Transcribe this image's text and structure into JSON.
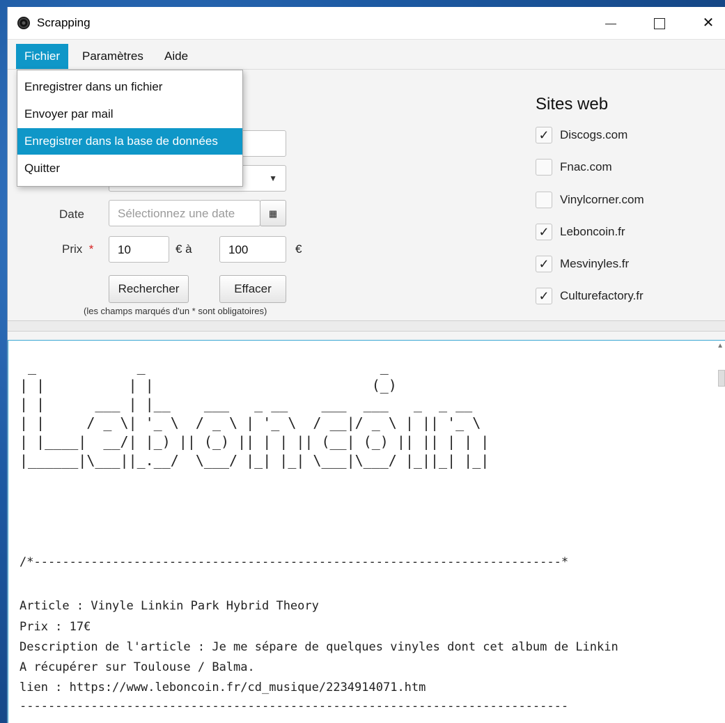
{
  "window": {
    "title": "Scrapping"
  },
  "menu": {
    "items": [
      {
        "label": "Fichier"
      },
      {
        "label": "Paramètres"
      },
      {
        "label": "Aide"
      }
    ],
    "dropdown": [
      {
        "label": "Enregistrer dans un fichier"
      },
      {
        "label": "Envoyer par mail"
      },
      {
        "label": "Enregistrer dans la base de données",
        "highlighted": true
      },
      {
        "label": "Quitter"
      }
    ]
  },
  "form": {
    "date_label": "Date",
    "date_placeholder": "Sélectionnez une date",
    "price_label": "Prix",
    "required_mark": "*",
    "price_min": "10",
    "price_between": "€ à",
    "price_max": "100",
    "price_unit": "€",
    "search_button": "Rechercher",
    "clear_button": "Effacer",
    "hint": "(les champs marqués d'un * sont obligatoires)"
  },
  "sites": {
    "title": "Sites web",
    "items": [
      {
        "label": "Discogs.com",
        "checked": true
      },
      {
        "label": "Fnac.com",
        "checked": false
      },
      {
        "label": "Vinylcorner.com",
        "checked": false
      },
      {
        "label": "Leboncoin.fr",
        "checked": true
      },
      {
        "label": "Mesvinyles.fr",
        "checked": true
      },
      {
        "label": "Culturefactory.fr",
        "checked": true
      }
    ]
  },
  "output": {
    "ascii_banner": " _            _                            _\n| |          | |                          (_)\n| |      ___ | |__    ___   _ __    ___  ___   _  _ __\n| |     / _ \\| '_ \\  / _ \\ | '_ \\  / __|/ _ \\ | || '_ \\\n| |____|  __/| |_) || (_) || | | || (__| (_) || || | | |\n|______|\\___||_.__/  \\___/ |_| |_| \\___|\\___/ |_||_| |_|",
    "separator_top": "/*--------------------------------------------------------------------------*",
    "article": "Article : Vinyle Linkin Park Hybrid Theory",
    "price": "Prix : 17€",
    "description": "Description de l'article : Je me sépare de quelques vinyles dont cet album de Linkin",
    "pickup": "A récupérer sur Toulouse / Balma.",
    "link": "lien : https://www.leboncoin.fr/cd_musique/2234914071.htm",
    "separator_bottom": "-----------------------------------------------------------------------------"
  }
}
